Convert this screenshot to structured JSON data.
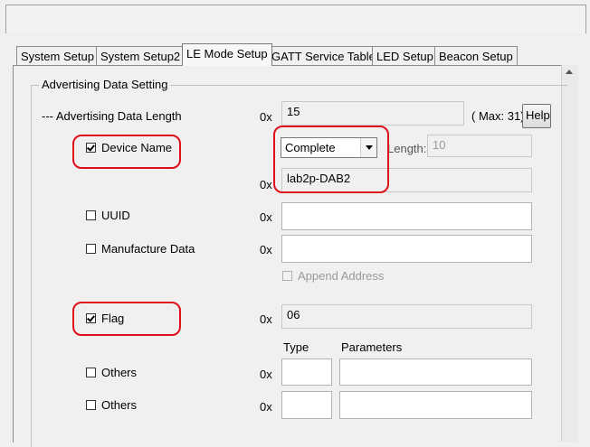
{
  "tabs": [
    {
      "label": "System Setup"
    },
    {
      "label": "System Setup2"
    },
    {
      "label": "LE Mode Setup"
    },
    {
      "label": "GATT Service Table"
    },
    {
      "label": "LED Setup"
    },
    {
      "label": "Beacon Setup"
    }
  ],
  "active_tab": "LE Mode Setup",
  "group_title": "Advertising Data Setting",
  "adv_length": {
    "label": "--- Advertising Data Length",
    "prefix": "0x",
    "value": "15",
    "max_text": "( Max: 31)",
    "help_label": "Help"
  },
  "device_name": {
    "label": "Device Name",
    "checked": true,
    "select_value": "Complete",
    "length_label": "Length:",
    "length_value": "10",
    "prefix": "0x",
    "value": "lab2p-DAB2"
  },
  "uuid": {
    "label": "UUID",
    "checked": false,
    "prefix": "0x",
    "value": ""
  },
  "manufacture": {
    "label": "Manufacture Data",
    "checked": false,
    "prefix": "0x",
    "value": ""
  },
  "append_address": {
    "label": "Append Address",
    "checked": false
  },
  "flag": {
    "label": "Flag",
    "checked": true,
    "prefix": "0x",
    "value": "06"
  },
  "columns": {
    "type": "Type",
    "parameters": "Parameters"
  },
  "others": [
    {
      "label": "Others",
      "checked": false,
      "prefix": "0x",
      "type_value": "",
      "param_value": ""
    },
    {
      "label": "Others",
      "checked": false,
      "prefix": "0x",
      "type_value": "",
      "param_value": ""
    }
  ],
  "colors": {
    "highlight": "#e0101a",
    "panel_bg": "#f0f0f0"
  }
}
